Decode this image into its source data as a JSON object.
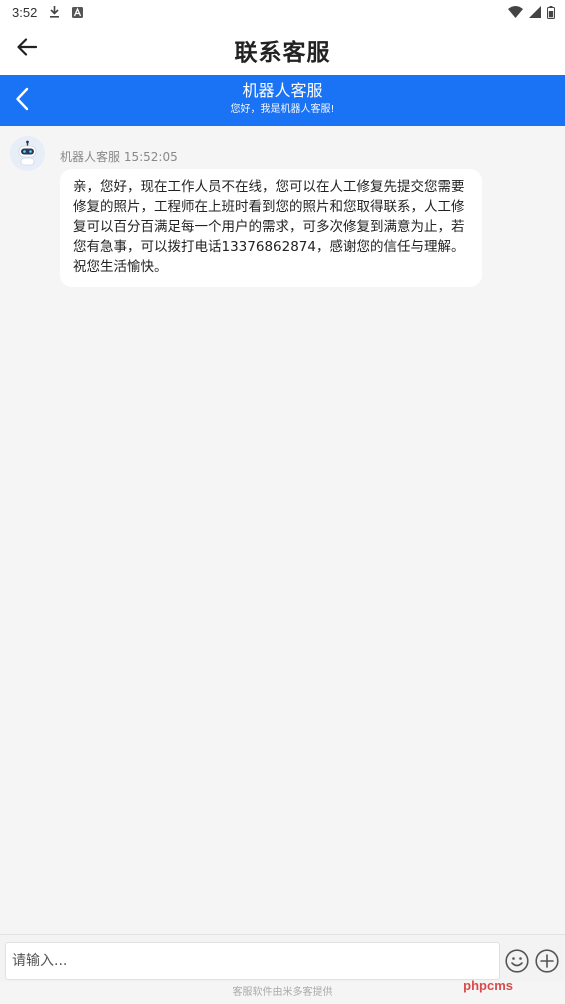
{
  "status_bar": {
    "time": "3:52",
    "icons_left": [
      "download-icon",
      "a-letter-icon"
    ],
    "icons_right": [
      "wifi-icon",
      "signal-icon",
      "battery-icon"
    ]
  },
  "app_bar": {
    "title": "联系客服",
    "back_icon": "arrow-left-icon"
  },
  "chat_header": {
    "title": "机器人客服",
    "subtitle": "您好，我是机器人客服!",
    "back_icon": "chevron-left-icon",
    "background": "#1a73f5"
  },
  "messages": [
    {
      "sender": "机器人客服",
      "time": "15:52:05",
      "meta": "机器人客服 15:52:05",
      "text": "亲，您好，现在工作人员不在线，您可以在人工修复先提交您需要修复的照片，工程师在上班时看到您的照片和您取得联系，人工修复可以百分百满足每一个用户的需求，可多次修复到满意为止，若您有急事，可以拨打电话13376862874，感谢您的信任与理解。祝您生活愉快。"
    }
  ],
  "input_bar": {
    "placeholder": "请输入...",
    "value": "",
    "emoji_icon": "smiley-icon",
    "plus_icon": "plus-circle-icon"
  },
  "footer": {
    "text": "客服软件由米多客提供"
  },
  "watermark": {
    "text": "phpcms"
  }
}
